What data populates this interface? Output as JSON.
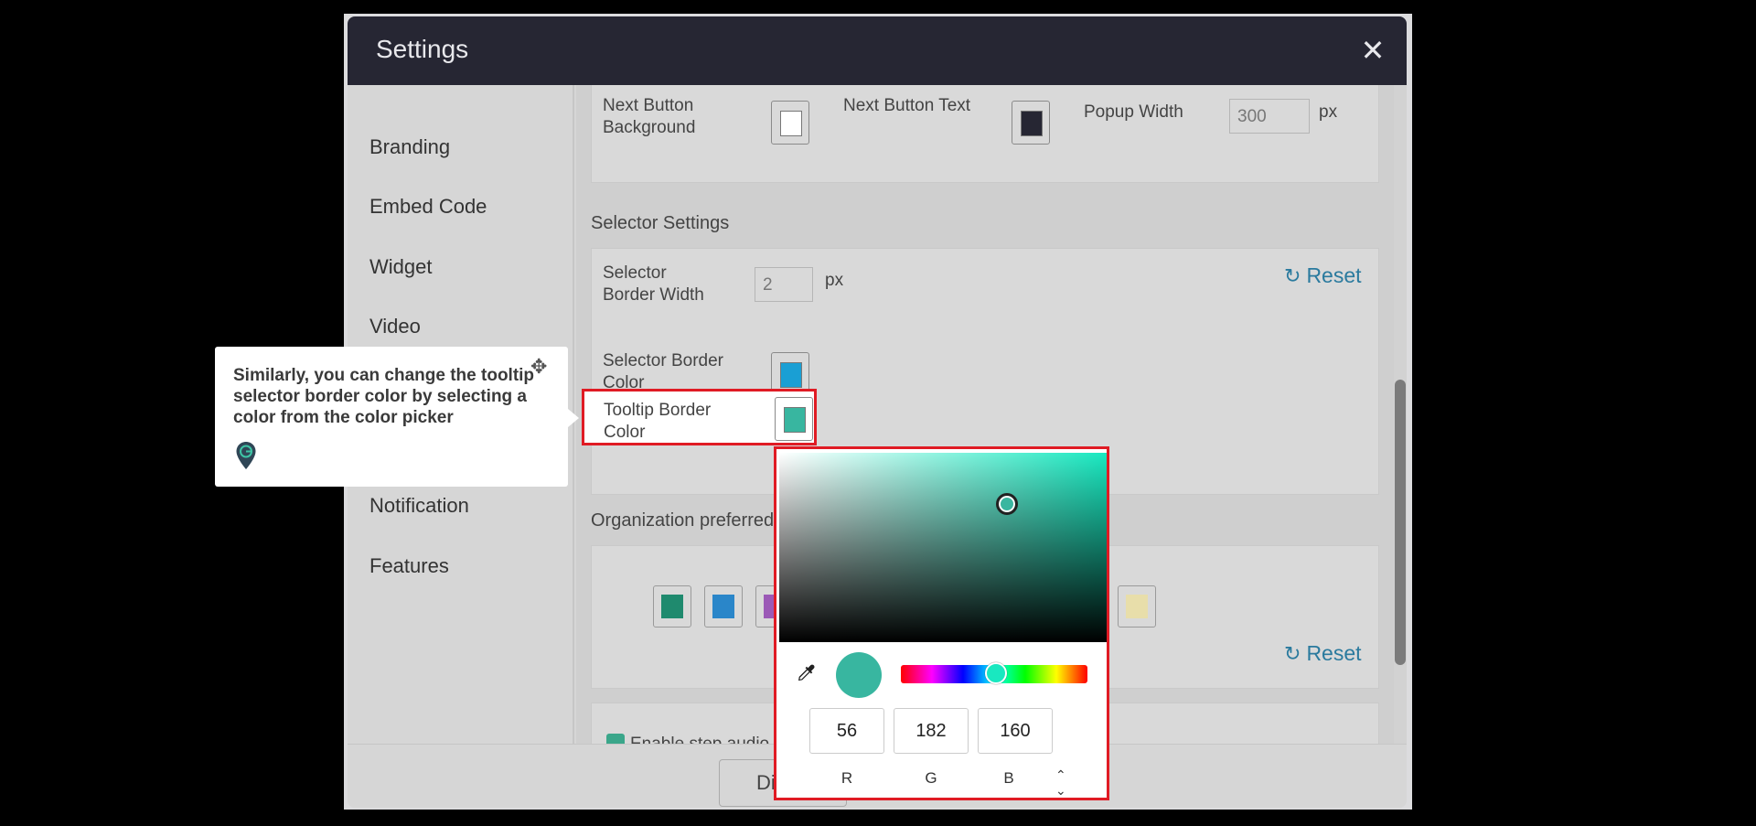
{
  "dialog": {
    "title": "Settings",
    "close_icon": "close-icon"
  },
  "sidebar": {
    "items": [
      {
        "label": "Branding"
      },
      {
        "label": "Embed Code"
      },
      {
        "label": "Widget"
      },
      {
        "label": "Video"
      },
      {
        "label": "Notification"
      },
      {
        "label": "Features"
      }
    ]
  },
  "popup_settings": {
    "next_button_background_label": "Next Button Background",
    "next_button_background_color": "#ffffff",
    "next_button_text_label": "Next Button Text",
    "next_button_text_color": "#262633",
    "popup_width_label": "Popup Width",
    "popup_width_value": "300",
    "popup_width_unit": "px"
  },
  "selector_settings": {
    "title": "Selector Settings",
    "border_width_label": "Selector Border Width",
    "border_width_value": "2",
    "border_width_unit": "px",
    "reset_label": "Reset",
    "border_color_label": "Selector Border Color",
    "border_color": "#1a9fd4",
    "tooltip_border_color_label": "Tooltip Border Color",
    "tooltip_border_color": "#38b6a0"
  },
  "org_colors": {
    "title": "Organization preferred",
    "swatches": [
      "#1f8a6e",
      "#2a86c9",
      "#9b59b6",
      "#e8deaa"
    ],
    "reset_label": "Reset"
  },
  "audio": {
    "label": "Enable step audio"
  },
  "footer": {
    "button_label": "Di"
  },
  "guide": {
    "text": "Similarly, you can change the tooltip selector border color by selecting a color from the color picker",
    "pin_icon": "location-pin-icon",
    "move_icon": "move-icon"
  },
  "color_picker": {
    "r": "56",
    "g": "182",
    "b": "160",
    "r_label": "R",
    "g_label": "G",
    "b_label": "B",
    "hue_color": "#19e8c0",
    "preview_color": "#38b6a0",
    "eyedropper_icon": "eyedropper-icon",
    "mode_toggle_icon": "up-down-toggle-icon"
  }
}
